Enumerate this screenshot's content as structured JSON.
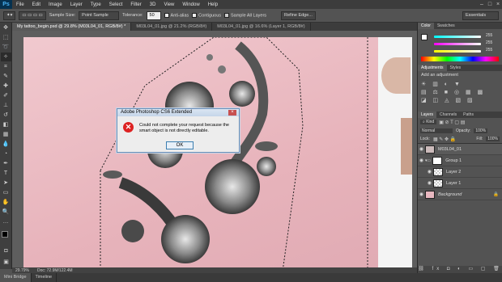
{
  "menu": {
    "logo": "Ps",
    "items": [
      "File",
      "Edit",
      "Image",
      "Layer",
      "Type",
      "Select",
      "Filter",
      "3D",
      "View",
      "Window",
      "Help"
    ]
  },
  "options": {
    "sample_size_label": "Sample Size:",
    "sample_size_value": "Point Sample",
    "tolerance_label": "Tolerance:",
    "tolerance_value": "50",
    "anti_alias": "Anti-alias",
    "contiguous": "Contiguous",
    "sample_all_layers": "Sample All Layers",
    "refine_edge": "Refine Edge...",
    "workspace": "Essentials"
  },
  "doc_tabs": [
    "My tattoo_begin.psd @ 29.8% (M03L04_01, RGB/8#) *",
    "M03L04_01.jpg @ 21.2% (RGB/8#)",
    "M03L04_01.jpg @ 16.6% (Layer 1, RGB/8#)"
  ],
  "status": {
    "zoom": "29.79%",
    "doc": "Doc: 72.9M/122.4M"
  },
  "bottom_tabs": [
    "Mini Bridge",
    "Timeline"
  ],
  "dialog": {
    "title": "Adobe Photoshop CS6 Extended",
    "message": "Could not complete your request because the smart object is not directly editable.",
    "ok": "OK",
    "icon": "error-icon"
  },
  "panels": {
    "color_tabs": [
      "Color",
      "Swatches"
    ],
    "color_values": {
      "r": "255",
      "g": "255",
      "b": "255"
    },
    "adjustments_tabs": [
      "Adjustments",
      "Styles"
    ],
    "add_adjustment": "Add an adjustment",
    "layers_tabs": [
      "Layers",
      "Channels",
      "Paths"
    ],
    "kind": "Kind",
    "blend_mode": "Normal",
    "opacity_label": "Opacity:",
    "opacity": "100%",
    "lock_label": "Lock:",
    "fill_label": "Fill:",
    "fill": "100%",
    "layers": [
      "M03L04_01",
      "Group 1",
      "Layer 2",
      "Layer 1",
      "Background"
    ]
  }
}
